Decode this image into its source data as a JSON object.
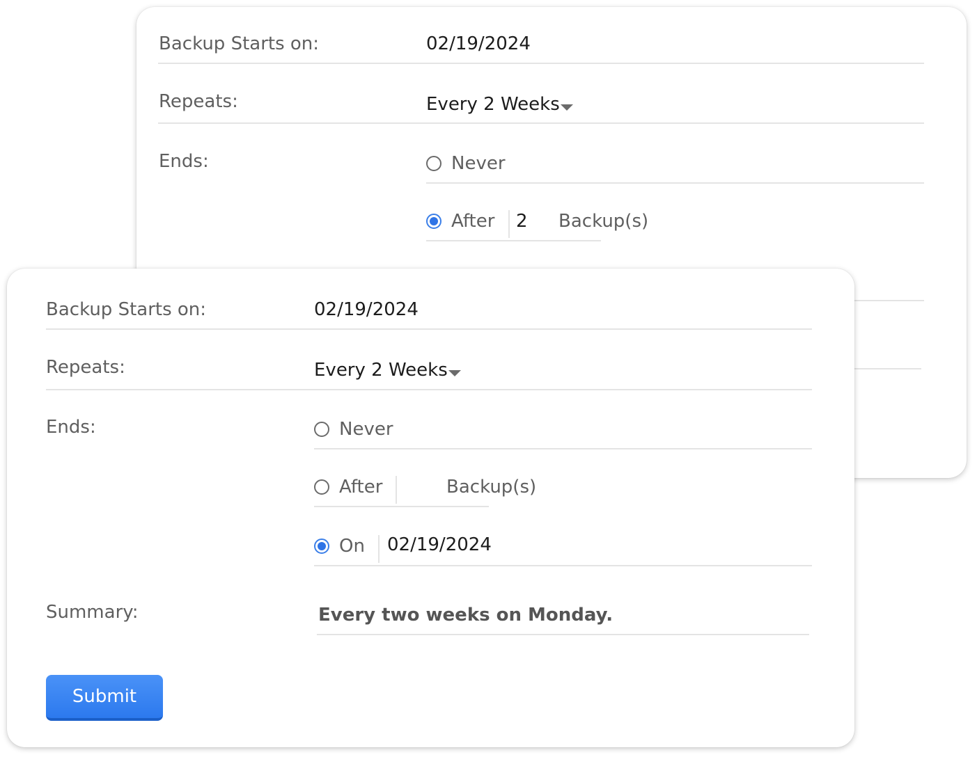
{
  "back_form": {
    "start_label": "Backup Starts on:",
    "start_value": "02/19/2024",
    "repeats_label": "Repeats:",
    "repeats_value": "Every 2 Weeks",
    "ends_label": "Ends:",
    "ends_never": "Never",
    "ends_after": "After",
    "after_count": "2",
    "after_unit": "Backup(s)",
    "selected_end_option": "After"
  },
  "front_form": {
    "start_label": "Backup Starts on:",
    "start_value": "02/19/2024",
    "repeats_label": "Repeats:",
    "repeats_value": "Every 2 Weeks",
    "ends_label": "Ends:",
    "ends_never": "Never",
    "ends_after": "After",
    "after_count": "",
    "after_unit": "Backup(s)",
    "ends_on": "On",
    "on_date": "02/19/2024",
    "selected_end_option": "On",
    "summary_label": "Summary:",
    "summary_value": "Every two weeks on Monday.",
    "submit_label": "Submit"
  },
  "colors": {
    "accent": "#2f74e6",
    "label_text": "#5f5f5f",
    "value_text": "#1c1c1c",
    "divider": "#e4e4e4"
  }
}
